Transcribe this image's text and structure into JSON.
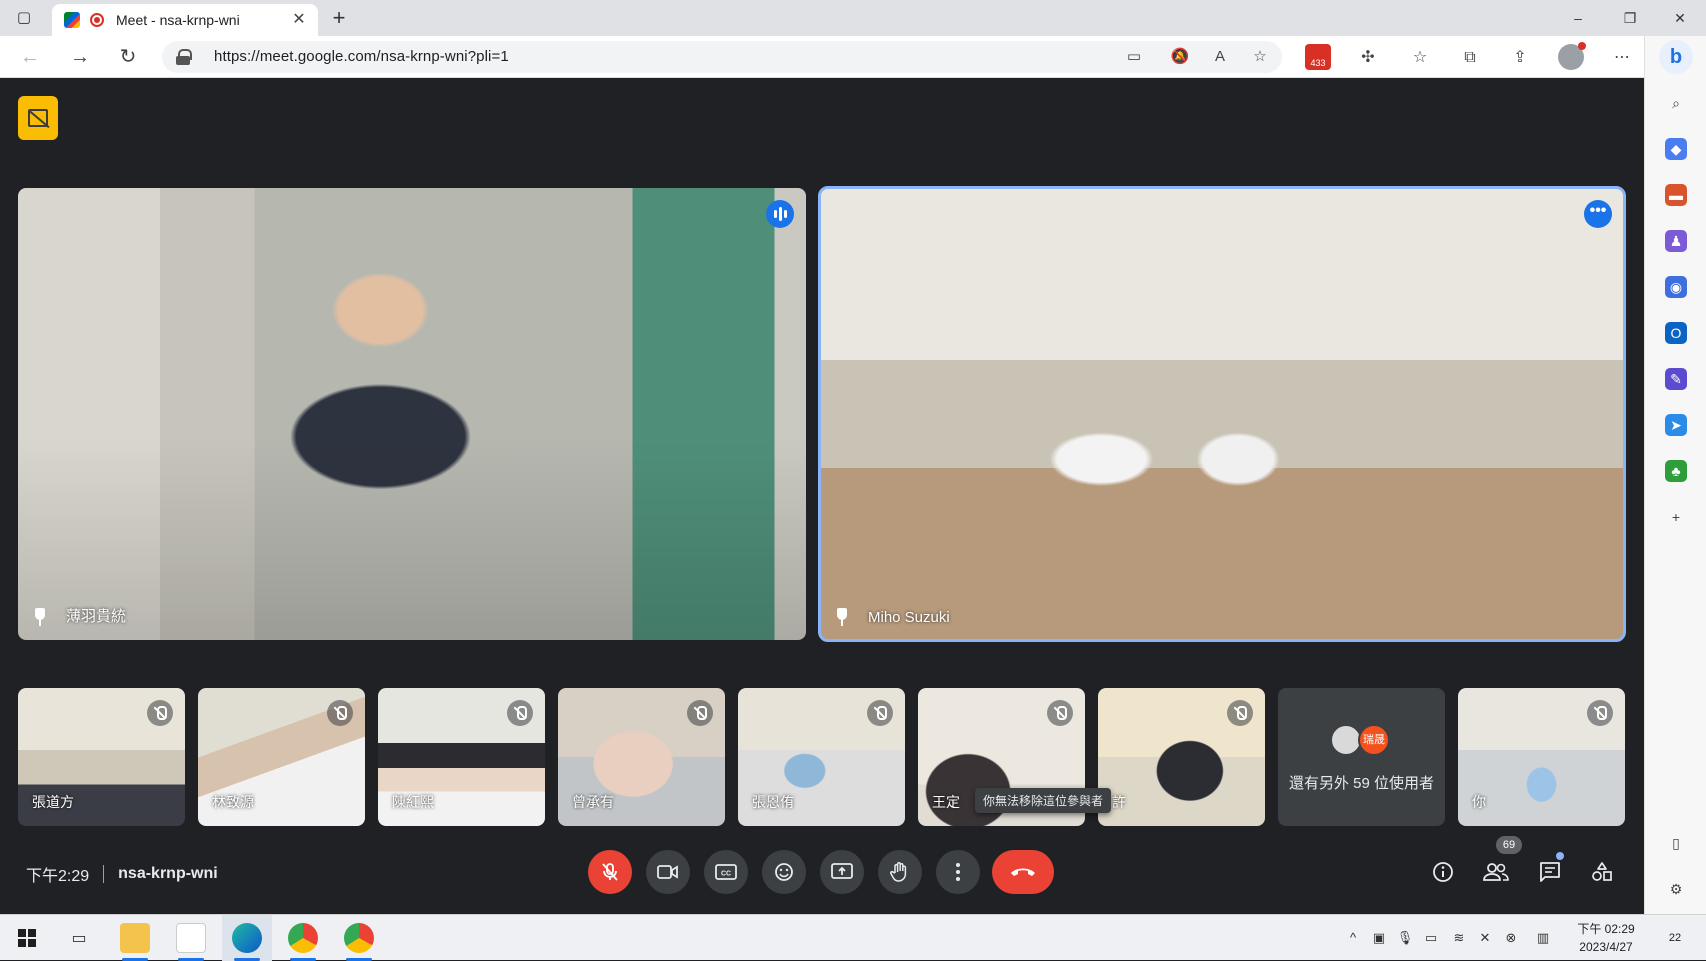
{
  "browser": {
    "tab_title": "Meet - nsa-krnp-wni",
    "url": "https://meet.google.com/nsa-krnp-wni?pli=1",
    "extension_badge": "433",
    "new_tab_symbol": "+",
    "window_controls": {
      "minimize": "–",
      "restore": "❐",
      "close": "✕"
    }
  },
  "meet": {
    "main_tiles": [
      {
        "name": "薄羽貴統",
        "state": "speaking"
      },
      {
        "name": "Miho Suzuki",
        "state": "focused"
      }
    ],
    "thumbnails": [
      {
        "name": "張道方"
      },
      {
        "name": "林致源"
      },
      {
        "name": "陳紅熙"
      },
      {
        "name": "曾承有"
      },
      {
        "name": "張恩侑"
      },
      {
        "name": "王定"
      },
      {
        "name": "許"
      }
    ],
    "others": {
      "text": "還有另外 59 位使用者",
      "avatar_initials": "瑞晟"
    },
    "self_tile": {
      "name": "你"
    },
    "tooltip": "你無法移除這位參與者",
    "time": "下午2:29",
    "meeting_code": "nsa-krnp-wni",
    "participant_count": "69"
  },
  "taskbar": {
    "clock_time": "下午 02:29",
    "clock_date": "2023/4/27",
    "notification_count": "22"
  },
  "colors": {
    "meet_bg": "#202124",
    "control_gray": "#3c4043",
    "danger_red": "#ea4335",
    "focus_blue": "#8ab4f8",
    "speaking_blue": "#1a73e8",
    "badge_yellow": "#fbbc04"
  }
}
